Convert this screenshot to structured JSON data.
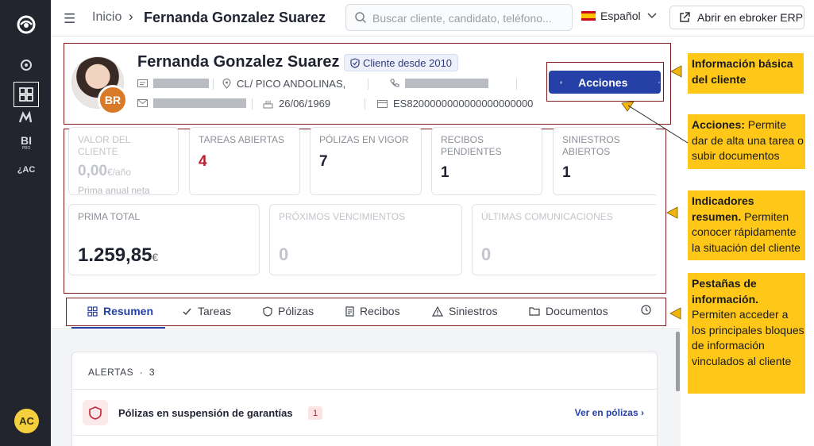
{
  "sidebar": {
    "avatar_initials": "AC",
    "items": [
      {
        "icon": "eye-logo-icon"
      },
      {
        "icon": "dashboard-grid-icon"
      },
      {
        "icon": "m-brand-icon"
      },
      {
        "label": "BI",
        "sub": "PRO"
      },
      {
        "label": "¿AC"
      }
    ]
  },
  "topbar": {
    "breadcrumb_home": "Inicio",
    "breadcrumb_sep": "›",
    "breadcrumb_current": "Fernanda Gonzalez Suarez",
    "search_placeholder": "Buscar cliente, candidato, teléfono...",
    "language": "Español",
    "erp_button": "Abrir en ebroker ERP"
  },
  "client": {
    "name": "Fernanda Gonzalez Suarez",
    "since_badge": "Cliente desde 2010",
    "initials": "BR",
    "address": "CL/ PICO ANDOLINAS,",
    "birth_date": "26/06/1969",
    "iban": "ES8200000000000000000000",
    "actions_button": "Acciones"
  },
  "kpis": {
    "valor": {
      "label": "VALOR DEL CLIENTE",
      "value": "0,00",
      "unit": "€/año",
      "sub": "Prima anual neta"
    },
    "tareas": {
      "label": "TAREAS ABIERTAS",
      "value": "4"
    },
    "polizas": {
      "label": "PÓLIZAS EN VIGOR",
      "value": "7"
    },
    "recibos": {
      "label": "RECIBOS PENDIENTES",
      "value": "1"
    },
    "siniestros": {
      "label": "SINIESTROS ABIERTOS",
      "value": "1"
    },
    "prima": {
      "label": "PRIMA TOTAL",
      "value": "1.259,85",
      "unit": "€"
    },
    "vencimientos": {
      "label": "PRÓXIMOS VENCIMIENTOS",
      "value": "0"
    },
    "comunicaciones": {
      "label": "ÚLTIMAS COMUNICACIONES",
      "value": "0"
    }
  },
  "tabs": [
    {
      "label": "Resumen",
      "icon": "grid-icon"
    },
    {
      "label": "Tareas",
      "icon": "check-icon"
    },
    {
      "label": "Pólizas",
      "icon": "shield-icon"
    },
    {
      "label": "Recibos",
      "icon": "receipt-icon"
    },
    {
      "label": "Siniestros",
      "icon": "warning-icon"
    },
    {
      "label": "Documentos",
      "icon": "folder-icon"
    }
  ],
  "alerts": {
    "title": "ALERTAS",
    "dot": "·",
    "count": "3",
    "item_title": "Pólizas en suspensión de garantías",
    "item_count": "1",
    "item_link": "Ver en pólizas"
  },
  "annotations": {
    "a1": "Información básica del cliente",
    "a2_bold": "Acciones:",
    "a2_text": " Permite dar de alta una tarea o subir documentos",
    "a3_bold": "Indicadores resumen.",
    "a3_text": " Permiten conocer rápidamente la situación del cliente",
    "a4_bold": "Pestañas de información.",
    "a4_text": " Permiten acceder a los principales bloques de información vinculados al cliente"
  },
  "colors": {
    "primary": "#2541a8",
    "annotation": "#ffc819",
    "rail": "#22252d",
    "alert_red": "#b91c2c"
  }
}
